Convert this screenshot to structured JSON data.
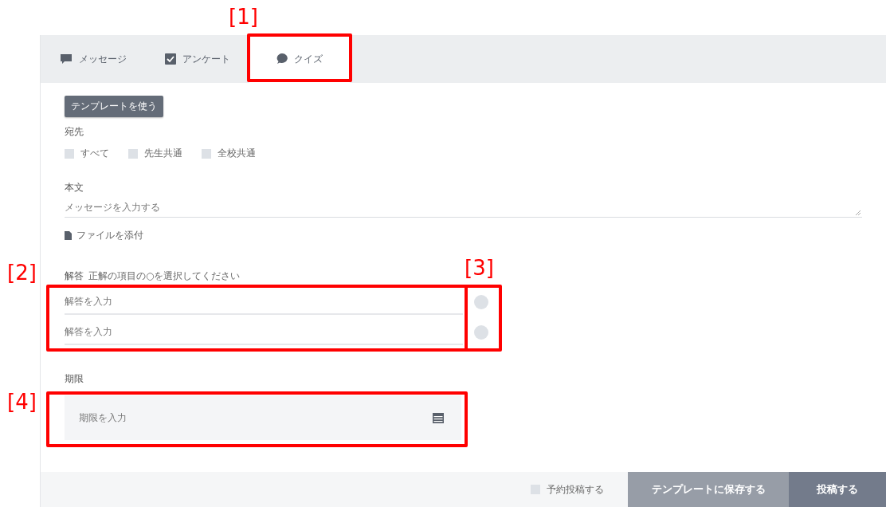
{
  "tabs": [
    {
      "label": "メッセージ",
      "selected": false
    },
    {
      "label": "アンケート",
      "selected": false
    },
    {
      "label": "クイズ",
      "selected": true
    }
  ],
  "template_button": "テンプレートを使う",
  "recipients": {
    "label": "宛先",
    "options": [
      {
        "label": "すべて",
        "checked": false
      },
      {
        "label": "先生共通",
        "checked": false
      },
      {
        "label": "全校共通",
        "checked": false
      }
    ]
  },
  "body": {
    "label": "本文",
    "placeholder": "メッセージを入力する"
  },
  "attach": "ファイルを添付",
  "answers": {
    "label": "解答",
    "hint": "正解の項目の○を選択してください",
    "items": [
      {
        "placeholder": "解答を入力",
        "selected": false
      },
      {
        "placeholder": "解答を入力",
        "selected": false
      }
    ]
  },
  "deadline": {
    "label": "期限",
    "placeholder": "期限を入力"
  },
  "footer": {
    "schedule": {
      "label": "予約投稿する",
      "checked": false
    },
    "save_button": "テンプレートに保存する",
    "post_button": "投稿する"
  },
  "annotations": [
    "[1]",
    "[2]",
    "[3]",
    "[4]"
  ]
}
